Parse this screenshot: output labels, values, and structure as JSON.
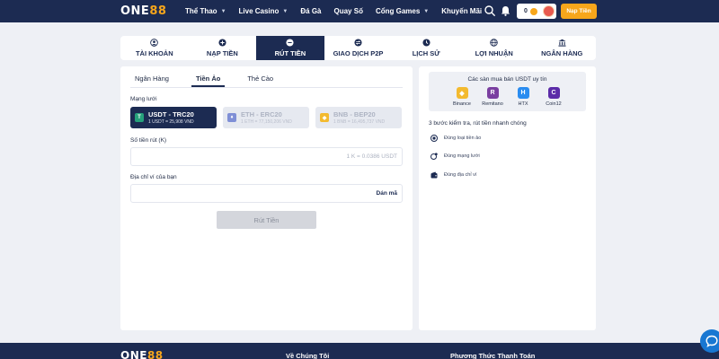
{
  "header": {
    "logo_main": "ONE",
    "logo_accent": "88",
    "nav": [
      {
        "label": "Thể Thao",
        "dropdown": true
      },
      {
        "label": "Live Casino",
        "dropdown": true
      },
      {
        "label": "Đá Gà",
        "dropdown": false
      },
      {
        "label": "Quay Số",
        "dropdown": false
      },
      {
        "label": "Cổng Games",
        "dropdown": true
      },
      {
        "label": "Khuyến Mãi",
        "dropdown": false
      }
    ],
    "balance": "0",
    "deposit_button": "Nạp Tiền"
  },
  "tabs": [
    {
      "label": "TÀI KHOẢN",
      "icon": "user-icon"
    },
    {
      "label": "NẠP TIỀN",
      "icon": "plus-circle-icon"
    },
    {
      "label": "RÚT TIỀN",
      "icon": "minus-circle-icon",
      "active": true
    },
    {
      "label": "GIAO DỊCH P2P",
      "icon": "exchange-icon"
    },
    {
      "label": "LỊCH SỬ",
      "icon": "clock-icon"
    },
    {
      "label": "LỢI NHUẬN",
      "icon": "globe-icon"
    },
    {
      "label": "NGÂN HÀNG",
      "icon": "bank-icon"
    }
  ],
  "withdraw": {
    "subtabs": [
      "Ngân Hàng",
      "Tiền Ảo",
      "Thẻ Cào"
    ],
    "active_subtab": 1,
    "network_label": "Mạng lưới",
    "networks": [
      {
        "name": "USDT - TRC20",
        "rate": "1 USDT = 25,908 VND",
        "icon": "tether-icon",
        "color": "#26a17b",
        "active": true
      },
      {
        "name": "ETH - ERC20",
        "rate": "1 ETH = 77,150,206 VND",
        "icon": "ethereum-icon",
        "color": "#7f8fd6",
        "active": false
      },
      {
        "name": "BNB - BEP20",
        "rate": "1 BNB = 16,495,737 VND",
        "icon": "bnb-icon",
        "color": "#f3ba2f",
        "active": false
      }
    ],
    "amount_label": "Số tiền rút (K)",
    "amount_hint": "1 K = 0.0386 USDT",
    "wallet_label": "Địa chỉ ví của bạn",
    "paste_label": "Dán mã",
    "submit_label": "Rút Tiền"
  },
  "side": {
    "exchanges_title": "Các sàn mua bán USDT uy tín",
    "exchanges": [
      {
        "name": "Binance",
        "icon": "binance-icon",
        "color": "#f3ba2f"
      },
      {
        "name": "Remitano",
        "icon": "remitano-icon",
        "color": "#7a3fa0"
      },
      {
        "name": "HTX",
        "icon": "htx-icon",
        "color": "#2a8cf0"
      },
      {
        "name": "Coin12",
        "icon": "coin12-icon",
        "color": "#5b2ba8"
      }
    ],
    "steps_title": "3 bước kiểm tra, rút tiền nhanh chóng",
    "steps": [
      {
        "label": "Đúng loại tiền ảo",
        "icon": "coin-check-icon"
      },
      {
        "label": "Đúng mạng lưới",
        "icon": "network-icon"
      },
      {
        "label": "Đúng địa chỉ ví",
        "icon": "wallet-icon"
      }
    ]
  },
  "footer": {
    "logo_main": "ONE",
    "logo_accent": "88",
    "col1_title": "Về Chúng Tôi",
    "col2_title": "Phương Thức Thanh Toán"
  }
}
